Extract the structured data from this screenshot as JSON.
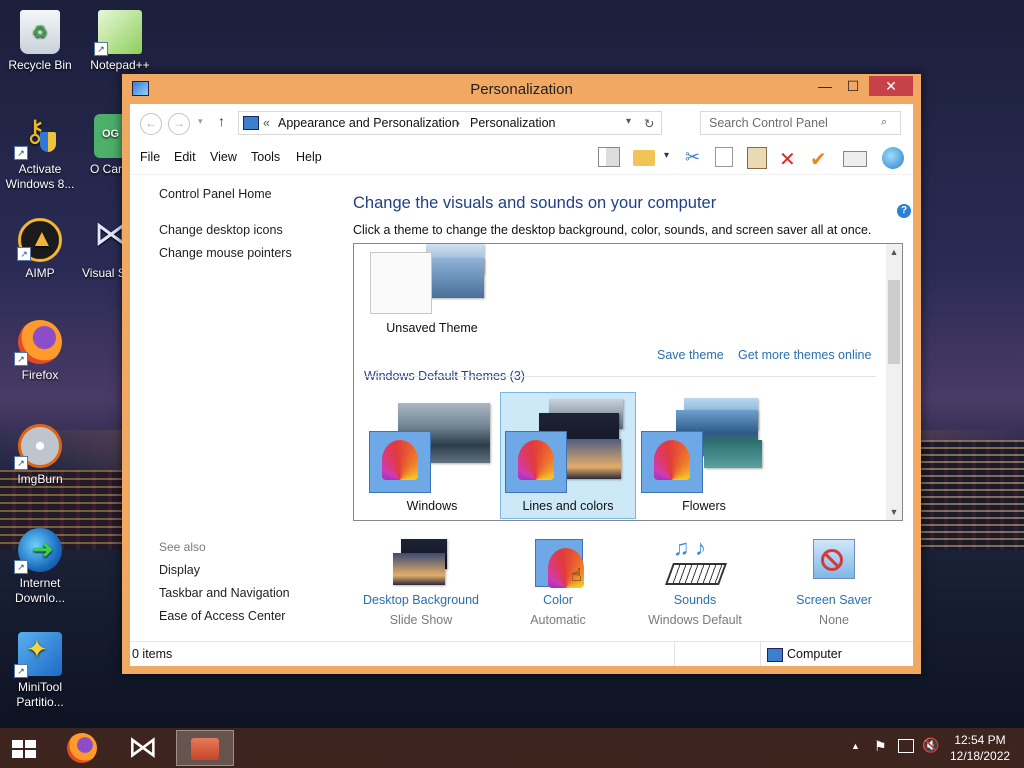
{
  "desktop": {
    "icons": [
      {
        "label": "Recycle Bin",
        "icon": "recycle-bin-icon"
      },
      {
        "label": "Notepad++",
        "icon": "notepadpp-icon"
      },
      {
        "label": "Activate Windows 8...",
        "icon": "key-shield-icon"
      },
      {
        "label": "O Car",
        "icon": "app-icon",
        "badge": "OG"
      },
      {
        "label": "AIMP",
        "icon": "aimp-icon"
      },
      {
        "label": "Visual S",
        "icon": "visual-studio-icon"
      },
      {
        "label": "Firefox",
        "icon": "firefox-icon"
      },
      {
        "label": "ImgBurn",
        "icon": "imgburn-icon"
      },
      {
        "label": "Internet Downlo...",
        "icon": "idm-icon"
      },
      {
        "label": "MiniTool Partitio...",
        "icon": "minitool-icon"
      }
    ]
  },
  "window": {
    "title": "Personalization",
    "controls": {
      "minimize": "—",
      "maximize": "☐",
      "close": "✕"
    },
    "address": {
      "prefix": "«",
      "crumb1": "Appearance and Personalization",
      "sep": "›",
      "crumb2": "Personalization"
    },
    "search_placeholder": "Search Control Panel",
    "menu": [
      "File",
      "Edit",
      "View",
      "Tools",
      "Help"
    ],
    "left": {
      "home": "Control Panel Home",
      "links": [
        "Change desktop icons",
        "Change mouse pointers"
      ],
      "see_also_title": "See also",
      "see_also": [
        "Display",
        "Taskbar and Navigation",
        "Ease of Access Center"
      ]
    },
    "main": {
      "title": "Change the visuals and sounds on your computer",
      "subtitle": "Click a theme to change the desktop background, color, sounds, and screen saver all at once.",
      "unsaved_theme": "Unsaved Theme",
      "save_theme": "Save theme",
      "get_more": "Get more themes online",
      "default_group": "Windows Default Themes (3)",
      "themes": [
        "Windows",
        "Lines and colors",
        "Flowers"
      ],
      "selected_theme": "Lines and colors"
    },
    "bottom": [
      {
        "label": "Desktop Background",
        "sub": "Slide Show"
      },
      {
        "label": "Color",
        "sub": "Automatic"
      },
      {
        "label": "Sounds",
        "sub": "Windows Default"
      },
      {
        "label": "Screen Saver",
        "sub": "None"
      }
    ],
    "status": {
      "items": "0 items",
      "location": "Computer"
    },
    "help": "?"
  },
  "taskbar": {
    "time": "12:54 PM",
    "date": "12/18/2022"
  }
}
